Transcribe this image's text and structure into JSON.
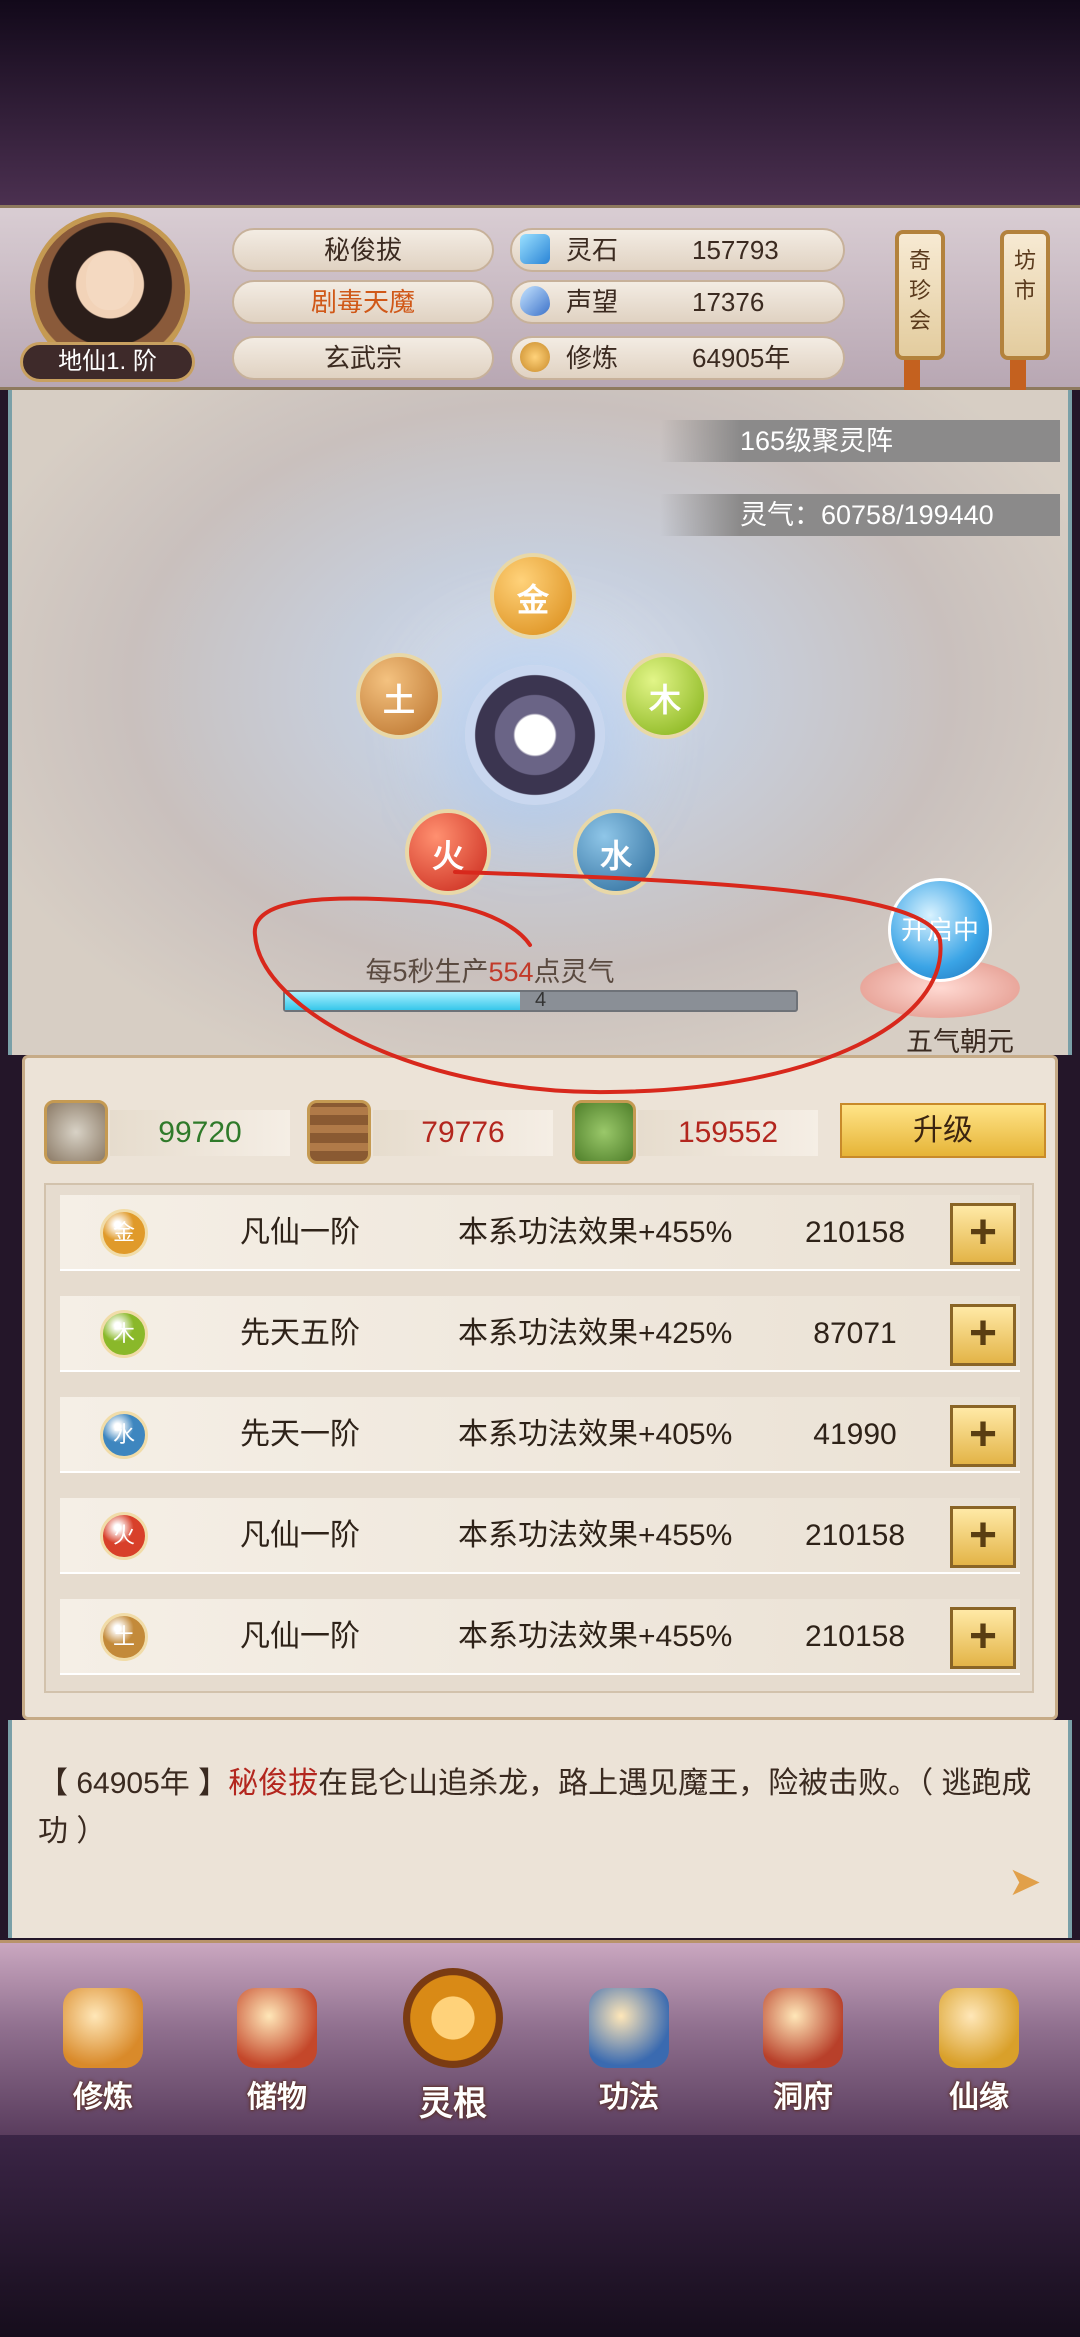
{
  "player": {
    "name": "秘俊拔",
    "title": "剧毒天魔",
    "sect": "玄武宗",
    "realm": "地仙1. 阶"
  },
  "resources": [
    {
      "label": "灵石",
      "value": "157793",
      "icon": "spirit-stone-icon"
    },
    {
      "label": "声望",
      "value": "17376",
      "icon": "reputation-icon"
    },
    {
      "label": "修炼",
      "value": "64905年",
      "icon": "cultivation-icon"
    }
  ],
  "side_buttons": {
    "treasure": "奇珍会",
    "market": "坊市"
  },
  "array": {
    "level_banner": "165级聚灵阵",
    "qi_banner": "灵气：60758/199440",
    "produce_prefix": "每5秒生产",
    "produce_rate": "554",
    "produce_suffix": "点灵气",
    "bar_label": "4",
    "bar_fraction": 0.46,
    "lotus_status": "开启中",
    "lotus_name": "五气朝元",
    "elements": {
      "jin": "金",
      "mu": "木",
      "tu": "土",
      "huo": "火",
      "shui": "水"
    }
  },
  "materials": [
    {
      "value": "99720",
      "icon": "ore-icon"
    },
    {
      "value": "79776",
      "icon": "wood-icon"
    },
    {
      "value": "159552",
      "icon": "herb-icon"
    }
  ],
  "upgrade_label": "升级",
  "element_rows": [
    {
      "element": "金",
      "rank": "凡仙一阶",
      "effect": "本系功法效果+455%",
      "value": "210158",
      "color": "#e09a2a"
    },
    {
      "element": "木",
      "rank": "先天五阶",
      "effect": "本系功法效果+425%",
      "value": "87071",
      "color": "#8ab82a"
    },
    {
      "element": "水",
      "rank": "先天一阶",
      "effect": "本系功法效果+405%",
      "value": "41990",
      "color": "#3e86bf"
    },
    {
      "element": "火",
      "rank": "凡仙一阶",
      "effect": "本系功法效果+455%",
      "value": "210158",
      "color": "#d8402a"
    },
    {
      "element": "土",
      "rank": "凡仙一阶",
      "effect": "本系功法效果+455%",
      "value": "210158",
      "color": "#c38a3a"
    }
  ],
  "plus_label": "+",
  "log": {
    "prefix": "【 64905年 】",
    "who": "秘俊拔",
    "text": "在昆仑山追杀龙，路上遇见魔王，险被击败。（ 逃跑成功 ）"
  },
  "nav": [
    {
      "label": "修炼",
      "icon": "cultivate-icon",
      "color": "#d98a2a"
    },
    {
      "label": "储物",
      "icon": "storage-bag-icon",
      "color": "#c4472a"
    },
    {
      "label": "灵根",
      "icon": "spirit-root-icon",
      "color": "#d98a16"
    },
    {
      "label": "功法",
      "icon": "technique-book-icon",
      "color": "#3a6ab0"
    },
    {
      "label": "洞府",
      "icon": "cave-dwelling-icon",
      "color": "#b8402a"
    },
    {
      "label": "仙缘",
      "icon": "fortune-gourd-icon",
      "color": "#d9a02a"
    }
  ]
}
